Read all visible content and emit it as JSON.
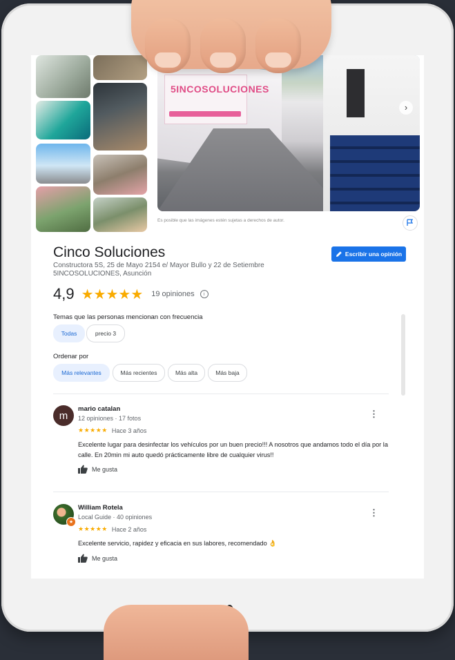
{
  "business": {
    "name": "Cinco Soluciones",
    "address_line1": "Constructora 5S, 25 de Mayo 2154 e/ Mayor Bullo y 22 de Setiembre",
    "address_line2": "5INCOSOLUCIONES, Asunción",
    "rating": "4,9",
    "stars": "★★★★★",
    "reviews_count": "19 opiniones",
    "sign_text": "5INCOSOLUCIONES"
  },
  "photos": {
    "disclaimer": "Es posible que las imágenes estén sujetas a derechos de autor.",
    "next_arrow": "›"
  },
  "actions": {
    "write_review": "Escribir una opinión"
  },
  "topics": {
    "label": "Temas que las personas mencionan con frecuencia",
    "chips": [
      {
        "label": "Todas",
        "active": true
      },
      {
        "label": "precio  3",
        "active": false
      }
    ]
  },
  "sort": {
    "label": "Ordenar por",
    "options": [
      {
        "label": "Más relevantes",
        "active": true
      },
      {
        "label": "Más recientes",
        "active": false
      },
      {
        "label": "Más alta",
        "active": false
      },
      {
        "label": "Más baja",
        "active": false
      }
    ]
  },
  "reviews": [
    {
      "initial": "m",
      "name": "mario catalan",
      "meta": "12 opiniones · 17 fotos",
      "stars": "★★★★★",
      "time": "Hace 3 años",
      "text": "Excelente lugar para desinfectar los vehículos por un buen precio!!! A nosotros que andamos todo el día por la calle. En 20min mi auto quedó prácticamente libre de cualquier virus!!",
      "like_label": "Me gusta"
    },
    {
      "initial": "",
      "name": "William Rotela",
      "meta": "Local Guide · 40 opiniones",
      "stars": "★★★★★",
      "time": "Hace 2 años",
      "text": "Excelente servicio, rapidez y eficacia en sus labores, recomendado 👌",
      "like_label": "Me gusta"
    }
  ],
  "colors": {
    "accent": "#1a73e8",
    "star": "#f9ab00",
    "chip_active_bg": "#e8f0fe"
  }
}
